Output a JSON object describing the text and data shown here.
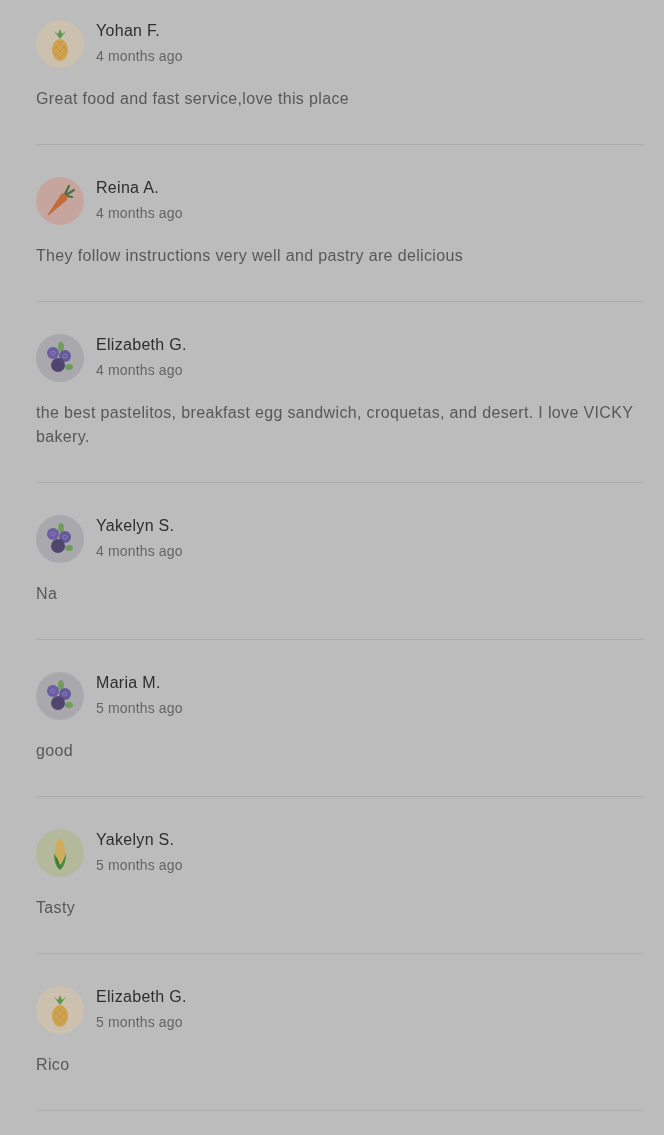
{
  "reviews": [
    {
      "avatar": {
        "kind": "pineapple"
      },
      "author": "Yohan F.",
      "time": "4 months ago",
      "text": "Great food and fast service,love this place"
    },
    {
      "avatar": {
        "kind": "carrot"
      },
      "author": "Reina A.",
      "time": "4 months ago",
      "text": "They follow instructions very well and pastry are delicious"
    },
    {
      "avatar": {
        "kind": "blueberry"
      },
      "author": "Elizabeth G.",
      "time": "4 months ago",
      "text": "the best pastelitos, breakfast egg sandwich, croquetas, and desert. I love VICKY bakery."
    },
    {
      "avatar": {
        "kind": "blueberry"
      },
      "author": "Yakelyn S.",
      "time": "4 months ago",
      "text": "Na"
    },
    {
      "avatar": {
        "kind": "blueberry"
      },
      "author": "Maria M.",
      "time": "5 months ago",
      "text": "good"
    },
    {
      "avatar": {
        "kind": "corn"
      },
      "author": "Yakelyn S.",
      "time": "5 months ago",
      "text": "Tasty"
    },
    {
      "avatar": {
        "kind": "pineapple"
      },
      "author": "Elizabeth G.",
      "time": "5 months ago",
      "text": "Rico"
    }
  ]
}
